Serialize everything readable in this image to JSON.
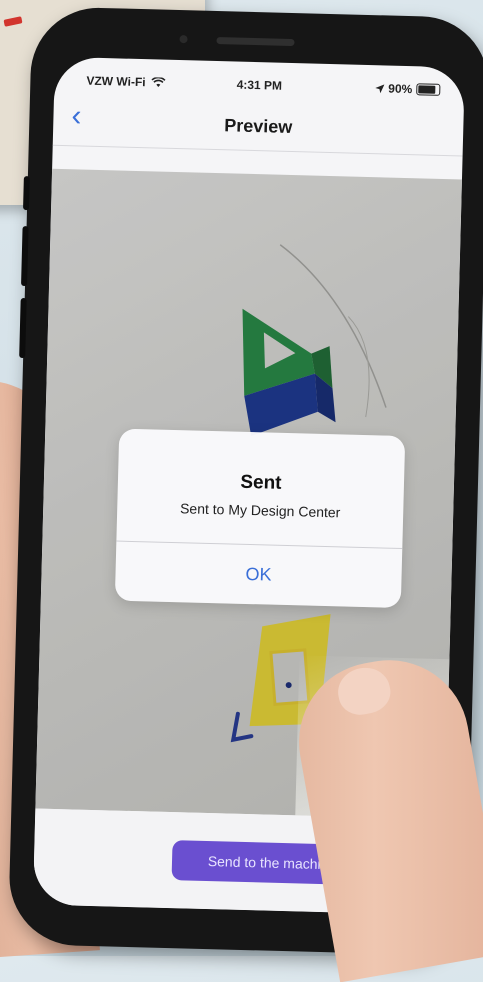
{
  "status_bar": {
    "carrier": "VZW Wi-Fi",
    "time": "4:31 PM",
    "battery": "90%"
  },
  "nav": {
    "back_glyph": "‹",
    "title": "Preview"
  },
  "alert": {
    "title": "Sent",
    "message": "Sent to My Design Center",
    "ok_label": "OK"
  },
  "actions": {
    "send_label": "Send to the machine"
  },
  "colors": {
    "accent": "#3a6fd8",
    "button": "#6a4fd0"
  },
  "icons": {
    "wifi": "wifi-icon",
    "location": "location-arrow-icon",
    "battery": "battery-icon",
    "back": "chevron-left-icon"
  }
}
